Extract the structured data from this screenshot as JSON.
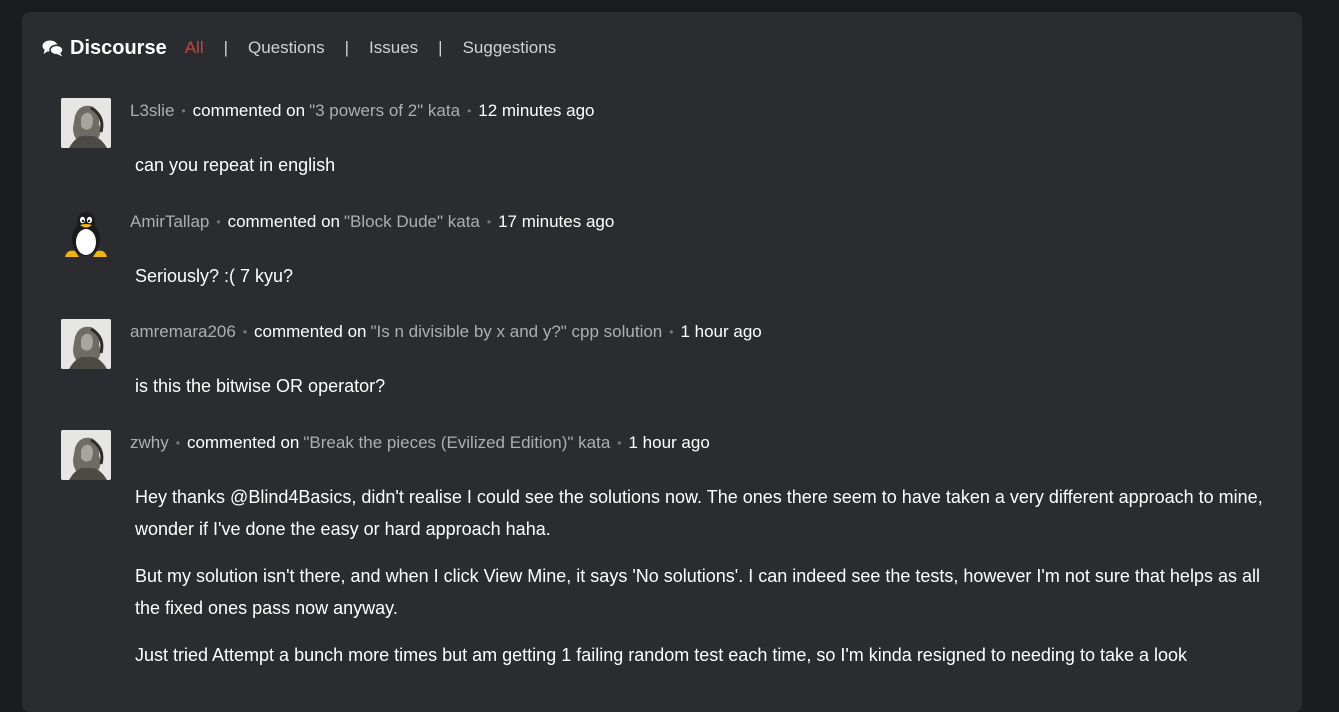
{
  "header": {
    "brand": "Discourse",
    "filters": [
      "All",
      "Questions",
      "Issues",
      "Suggestions"
    ],
    "separator": "|",
    "brand_icon": "comments-icon"
  },
  "colors": {
    "active_filter": "#c9453a",
    "panel_bg": "#2b2c2f",
    "page_bg": "#1b1c1e"
  },
  "comments": [
    {
      "user": "L3slie",
      "action": "commented on",
      "target": "\"3 powers of 2\" kata",
      "time": "12 minutes ago",
      "avatar": "bw-photo-avatar",
      "paragraphs": [
        "can you repeat in english"
      ]
    },
    {
      "user": "AmirTallap",
      "action": "commented on",
      "target": "\"Block Dude\" kata",
      "time": "17 minutes ago",
      "avatar": "penguin-avatar",
      "paragraphs": [
        "Seriously? :( 7 kyu?"
      ]
    },
    {
      "user": "amremara206",
      "action": "commented on",
      "target": "\"Is n divisible by x and y?\" cpp solution",
      "time": "1 hour ago",
      "avatar": "bw-photo-avatar",
      "paragraphs": [
        "is this the bitwise OR operator?"
      ]
    },
    {
      "user": "zwhy",
      "action": "commented on",
      "target": "\"Break the pieces (Evilized Edition)\" kata",
      "time": "1 hour ago",
      "avatar": "bw-photo-avatar",
      "paragraphs": [
        "Hey thanks @Blind4Basics, didn't realise I could see the solutions now. The ones there seem to have taken a very different approach to mine, wonder if I've done the easy or hard approach haha.",
        "But my solution isn't there, and when I click View Mine, it says 'No solutions'. I can indeed see the tests, however I'm not sure that helps as all the fixed ones pass now anyway.",
        "Just tried Attempt a bunch more times but am getting 1 failing random test each time, so I'm kinda resigned to needing to take a look"
      ]
    }
  ]
}
